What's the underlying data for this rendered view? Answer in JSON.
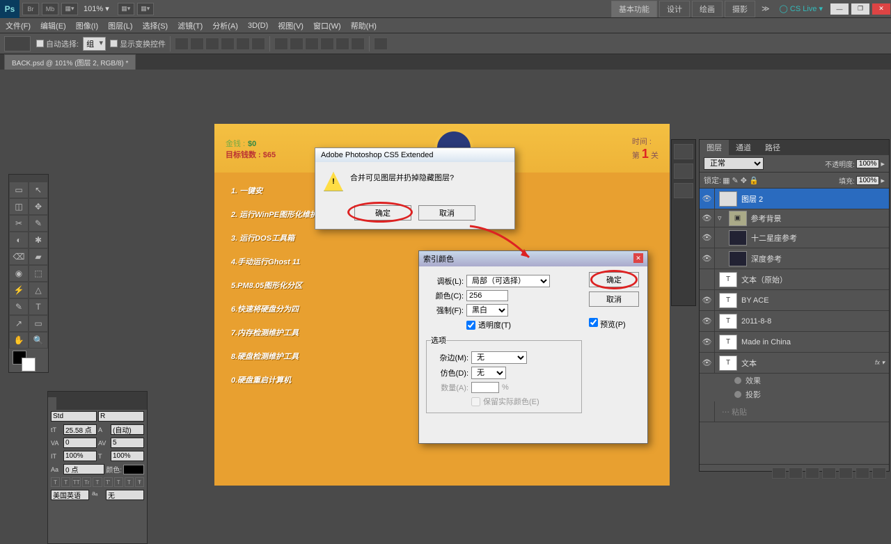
{
  "app_top": {
    "logo": "Ps",
    "btns": [
      "Br",
      "Mb",
      "▦▾",
      "",
      "▦▾",
      "▦▾"
    ],
    "zoom": "101% ▾",
    "workspaces": [
      "基本功能",
      "设计",
      "绘画",
      "摄影"
    ],
    "more": "≫",
    "cslive": "◯ CS Live ▾",
    "win": [
      "—",
      "❐",
      "✕"
    ]
  },
  "menu": [
    "文件(F)",
    "编辑(E)",
    "图像(I)",
    "图层(L)",
    "选择(S)",
    "滤镜(T)",
    "分析(A)",
    "3D(D)",
    "视图(V)",
    "窗口(W)",
    "帮助(H)"
  ],
  "options": {
    "auto_select": "自动选择:",
    "group": "组",
    "show_transform": "显示变换控件"
  },
  "doc_tab": "BACK.psd @ 101% (图层 2, RGB/8) *",
  "canvas": {
    "money_label": "金钱 :",
    "money_value": "$0",
    "goal_label": "目标钱数 :",
    "goal_value": "$65",
    "time_label": "时间 :",
    "level_prefix": "第",
    "level_num": "1",
    "level_suffix": "关",
    "lines": [
      "1. 一键安",
      "2. 运行WinPE图形化维护工具",
      "3. 运行DOS工具箱",
      "4.手动运行Ghost 11",
      "5.PM8.05图形化分区",
      "6.快速将硬盘分为四",
      "7.内存检测维护工具",
      "8.硬盘检测维护工具",
      "0.硬盘重启计算机"
    ]
  },
  "tools": [
    "▭",
    "↖",
    "◫",
    "✥",
    "✂",
    "✎",
    "◐",
    "✱",
    "⌫",
    "▰",
    "◉",
    "⬚",
    "⚡",
    "△",
    "✎",
    "T",
    "↗",
    "▭",
    "✋",
    "🔍"
  ],
  "char": {
    "tab1": "Std",
    "tab2": "R",
    "size": "25.58 点",
    "leading": "(自动)",
    "va": "0",
    "av": "5",
    "it": "100%",
    "height": "100%",
    "baseline": "0 点",
    "color_label": "颜色:",
    "styles": [
      "T",
      "T",
      "TT",
      "Tr",
      "T",
      "T'",
      "T",
      "T",
      "Ŧ"
    ],
    "lang": "美国英语",
    "aa_label": "aₐ",
    "aa": "无"
  },
  "alert": {
    "title": "Adobe Photoshop CS5 Extended",
    "message": "合并可见图层并扔掉隐藏图层?",
    "ok": "确定",
    "cancel": "取消"
  },
  "index": {
    "title": "索引颜色",
    "palette_label": "调板(L):",
    "palette_value": "局部（可选择）",
    "colors_label": "颜色(C):",
    "colors_value": "256",
    "forced_label": "强制(F):",
    "forced_value": "黑白",
    "transparency": "透明度(T)",
    "options_legend": "选项",
    "matte_label": "杂边(M):",
    "matte_value": "无",
    "dither_label": "仿色(D):",
    "dither_value": "无",
    "amount_label": "数量(A):",
    "amount_suffix": "%",
    "preserve": "保留实际颜色(E)",
    "ok": "确定",
    "cancel": "取消",
    "preview": "预览(P)"
  },
  "layers": {
    "tabs": [
      "图层",
      "通道",
      "路径"
    ],
    "blend": "正常",
    "opacity_label": "不透明度:",
    "opacity_value": "100%",
    "lock_label": "锁定:",
    "fill_label": "填充:",
    "fill_value": "100%",
    "items": [
      {
        "name": "图层 2",
        "type": "layer",
        "selected": true
      },
      {
        "name": "参考背景",
        "type": "group"
      },
      {
        "name": "十二星座参考",
        "type": "layer",
        "indent": 1,
        "thumb": "dark"
      },
      {
        "name": "深度参考",
        "type": "layer",
        "indent": 1,
        "thumb": "dark"
      },
      {
        "name": "文本（原始）",
        "type": "text"
      },
      {
        "name": "BY ACE",
        "type": "text"
      },
      {
        "name": "2011-8-8",
        "type": "text"
      },
      {
        "name": "Made in China",
        "type": "text"
      },
      {
        "name": "文本",
        "type": "text",
        "fx": true
      }
    ],
    "fx_label": "fx ▾",
    "effects": "效果",
    "shadow": "投影",
    "more_layer": "⋯ 粘贴"
  }
}
